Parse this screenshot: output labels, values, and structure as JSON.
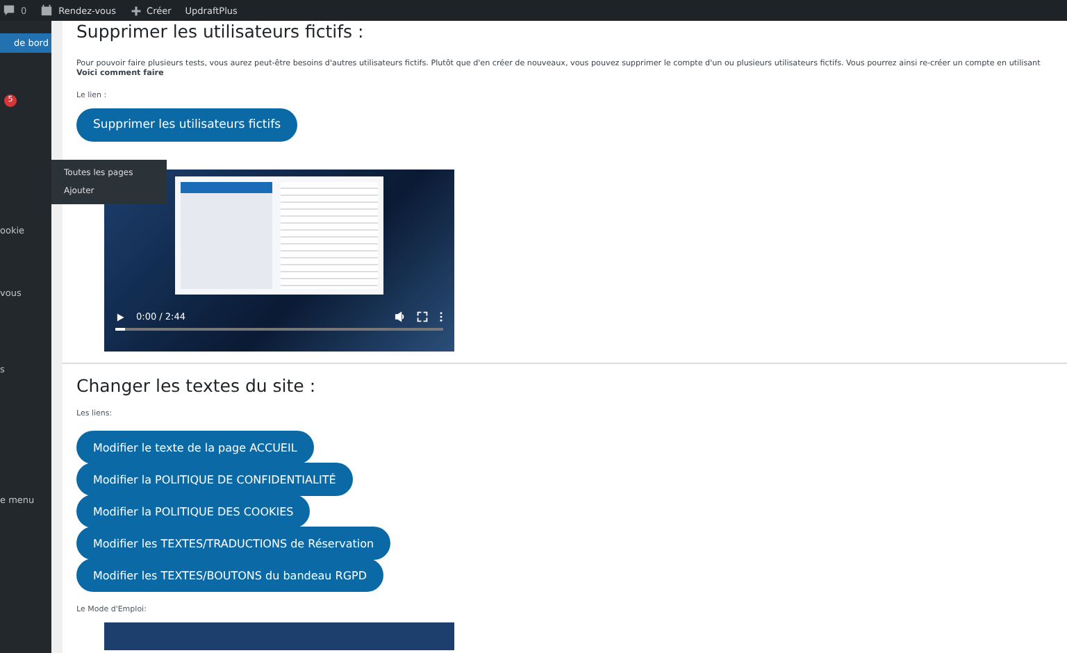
{
  "admin_bar": {
    "comments": "0",
    "items": [
      {
        "kind": "calendar",
        "label": "Rendez-vous"
      },
      {
        "kind": "plus",
        "label": "Créer"
      },
      {
        "kind": "none",
        "label": "UpdraftPlus"
      }
    ]
  },
  "sidebar": {
    "items": [
      {
        "label": "de bord",
        "selected": true
      },
      {
        "selected": false,
        "badge": "5"
      },
      {
        "label": "ookie",
        "selected": false
      },
      {
        "label": "vous",
        "selected": false
      },
      {
        "label": "s",
        "selected": false
      },
      {
        "label": "e menu",
        "selected": false
      }
    ]
  },
  "flyout": {
    "items": [
      "Toutes les pages",
      "Ajouter"
    ]
  },
  "section_delete": {
    "title": "Supprimer les utilisateurs fictifs :",
    "paragraph": "Pour pouvoir faire plusieurs tests, vous aurez peut-être besoins d'autres utilisateurs fictifs. Plutôt que d'en créer de nouveaux, vous pouvez supprimer le compte d'un ou plusieurs utilisateurs fictifs. Vous pourrez ainsi re-créer un compte en utilisant",
    "link_text": "Voici comment faire",
    "link_label": "Le lien :",
    "button": "Supprimer les utilisateurs fictifs",
    "video": {
      "time": "0:00 / 2:44",
      "level": 0.03
    }
  },
  "section_texts": {
    "title": "Changer les textes du site :",
    "links_label": "Les liens:",
    "buttons": [
      "Modifier le texte de la page ACCUEIL",
      "Modifier la POLITIQUE DE CONFIDENTIALITÉ",
      "Modifier la POLITIQUE DES COOKIES",
      "Modifier les TEXTES/TRADUCTIONS de Réservation",
      "Modifier les TEXTES/BOUTONS du bandeau RGPD"
    ],
    "manual_label": "Le Mode d'Emploi:"
  }
}
